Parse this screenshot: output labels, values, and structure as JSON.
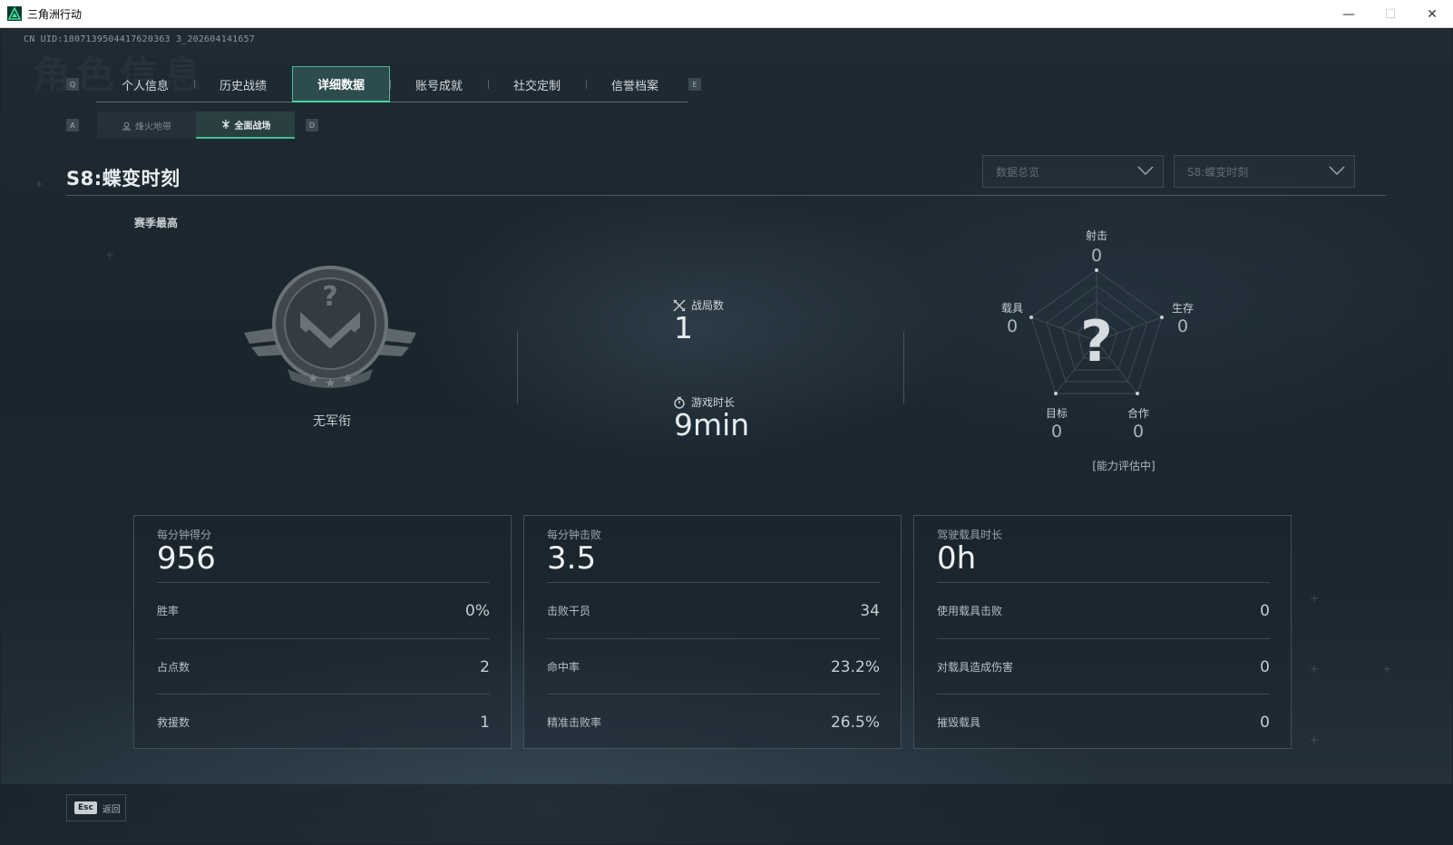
{
  "window": {
    "title": "三角洲行动",
    "minimize": "—",
    "maximize": "☐",
    "close": "✕"
  },
  "uid": "CN UID:1807139504417620363 3_202604141657",
  "bg_title": "角色信息",
  "tabs": {
    "left_key": "Q",
    "right_key": "E",
    "items": [
      {
        "label": "个人信息",
        "active": false
      },
      {
        "label": "历史战绩",
        "active": false
      },
      {
        "label": "详细数据",
        "active": true
      },
      {
        "label": "账号成就",
        "active": false
      },
      {
        "label": "社交定制",
        "active": false
      },
      {
        "label": "信誉档案",
        "active": false
      }
    ]
  },
  "subtabs": {
    "left_key": "A",
    "right_key": "D",
    "items": [
      {
        "label": "烽火地带",
        "active": false
      },
      {
        "label": "全面战场",
        "active": true
      }
    ]
  },
  "season_title": "S8:蝶变时刻",
  "dropdowns": {
    "view": "数据总览",
    "season": "S8:蝶变时刻"
  },
  "season_best_label": "赛季最高",
  "rank": {
    "name": "无军衔"
  },
  "match_stats": {
    "matches_label": "战局数",
    "matches_value": "1",
    "playtime_label": "游戏时长",
    "playtime_value": "9min"
  },
  "radar": {
    "center_symbol": "?",
    "status": "[能力评估中]",
    "axes": [
      {
        "label": "射击",
        "value": "0"
      },
      {
        "label": "生存",
        "value": "0"
      },
      {
        "label": "合作",
        "value": "0"
      },
      {
        "label": "目标",
        "value": "0"
      },
      {
        "label": "载具",
        "value": "0"
      }
    ]
  },
  "cards": [
    {
      "head_label": "每分钟得分",
      "head_value": "956",
      "rows": [
        {
          "label": "胜率",
          "value": "0%"
        },
        {
          "label": "占点数",
          "value": "2"
        },
        {
          "label": "救援数",
          "value": "1"
        }
      ]
    },
    {
      "head_label": "每分钟击败",
      "head_value": "3.5",
      "rows": [
        {
          "label": "击败干员",
          "value": "34"
        },
        {
          "label": "命中率",
          "value": "23.2%"
        },
        {
          "label": "精准击败率",
          "value": "26.5%"
        }
      ]
    },
    {
      "head_label": "驾驶载具时长",
      "head_value": "0h",
      "rows": [
        {
          "label": "使用载具击败",
          "value": "0"
        },
        {
          "label": "对载具造成伤害",
          "value": "0"
        },
        {
          "label": "摧毁载具",
          "value": "0"
        }
      ]
    }
  ],
  "footer": {
    "esc_key": "Esc",
    "back_label": "返回"
  },
  "colors": {
    "accent": "#44d4a0",
    "background": "#1b252d"
  }
}
